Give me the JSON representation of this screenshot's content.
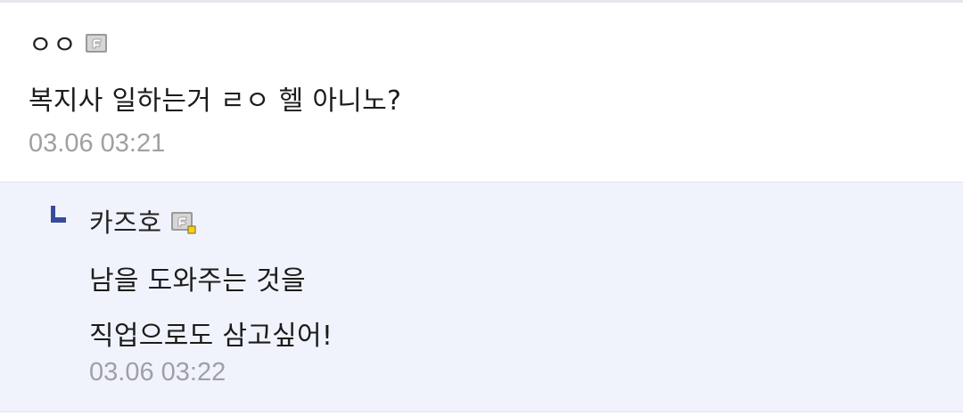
{
  "comment": {
    "author": "ㅇㅇ",
    "author_icon": "fixed-nick-icon",
    "body": "복지사 일하는거 ㄹㅇ 헬 아니노?",
    "timestamp": "03.06 03:21"
  },
  "reply": {
    "indicator_icon": "reply-arrow-icon",
    "author": "카즈호",
    "author_icon": "fixed-nick-manager-icon",
    "body": "남을 도와주는 것을\n직업으로도 삼고싶어!",
    "timestamp": "03.06 03:22"
  },
  "colors": {
    "reply_background": "#f0f3fb",
    "reply_indicator": "#3a4a9a",
    "timestamp": "#a0a0a4",
    "badge_accent": "#f5d020"
  }
}
